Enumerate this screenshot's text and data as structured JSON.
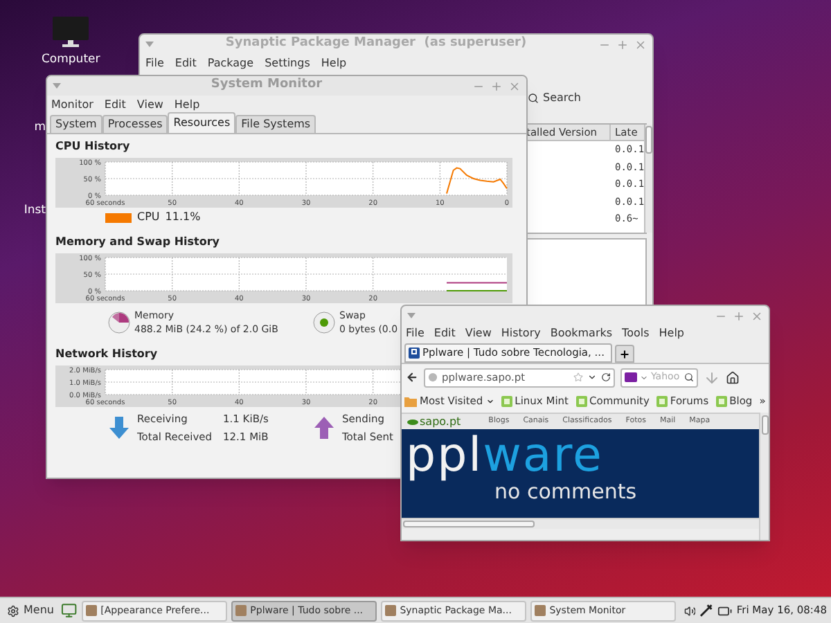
{
  "desktop": {
    "icons": [
      {
        "label": "Computer"
      }
    ],
    "partial_labels": [
      "m",
      "Inst"
    ]
  },
  "synaptic": {
    "title": "Synaptic Package Manager  (as superuser)",
    "menu": [
      "File",
      "Edit",
      "Package",
      "Settings",
      "Help"
    ],
    "toolbar": [
      "Search"
    ],
    "table": {
      "columns": [
        "talled Version",
        "Late"
      ],
      "latest_cells": [
        "0.0.1",
        "0.0.1",
        "0.0.1",
        "0.0.1",
        "0.6~"
      ]
    }
  },
  "system_monitor": {
    "title": "System Monitor",
    "menu": [
      "Monitor",
      "Edit",
      "View",
      "Help"
    ],
    "tabs": [
      {
        "label": "System",
        "selected": false
      },
      {
        "label": "Processes",
        "selected": false
      },
      {
        "label": "Resources",
        "selected": true
      },
      {
        "label": "File Systems",
        "selected": false
      }
    ],
    "cpu": {
      "heading": "CPU History",
      "chart_data": {
        "type": "line",
        "grid": true,
        "xlim": [
          60,
          0
        ],
        "ylim": [
          0,
          100
        ],
        "xticks": [
          {
            "value": 60,
            "label": "60 seconds"
          },
          50,
          40,
          30,
          20,
          10,
          0
        ],
        "yticks": [
          {
            "value": 100,
            "label": "100 %"
          },
          {
            "value": 50,
            "label": "50 %"
          },
          {
            "value": 0,
            "label": "0 %"
          }
        ],
        "x": [
          9,
          8.5,
          8,
          7.5,
          7,
          6,
          5,
          4,
          3,
          2,
          1,
          0.5,
          0
        ],
        "series": [
          {
            "name": "CPU",
            "color": "#f57900",
            "values": [
              5,
              40,
              75,
              82,
              80,
              60,
              50,
              45,
              42,
              40,
              48,
              35,
              20
            ]
          }
        ]
      },
      "legend": [
        {
          "value": "11.1%"
        }
      ]
    },
    "memory": {
      "heading": "Memory and Swap History",
      "chart_data": {
        "type": "line",
        "grid": true,
        "xlim": [
          60,
          0
        ],
        "ylim": [
          0,
          100
        ],
        "xticks": [
          {
            "value": 60,
            "label": "60 seconds"
          },
          50,
          40,
          30,
          20
        ],
        "yticks": [
          {
            "value": 100,
            "label": "100 %"
          },
          {
            "value": 50,
            "label": "50 %"
          },
          {
            "value": 0,
            "label": "0 %"
          }
        ],
        "x": [
          9,
          0
        ],
        "series": [
          {
            "name": "Memory",
            "color": "#ad3b7f",
            "values": [
              24,
              24
            ]
          },
          {
            "name": "Swap",
            "color": "#4e9a06",
            "values": [
              0,
              0
            ]
          }
        ]
      },
      "items": [
        {
          "kind": "pie",
          "detail": "488.2 MiB (24.2 %) of 2.0 GiB"
        },
        {
          "kind": "dot",
          "detail": "0 bytes (0.0"
        }
      ]
    },
    "network": {
      "heading": "Network History",
      "chart_data": {
        "type": "line",
        "grid": true,
        "xlim": [
          60,
          0
        ],
        "ylim": [
          0,
          2
        ],
        "xticks": [
          {
            "value": 60,
            "label": "60 seconds"
          },
          50,
          40,
          30,
          20
        ],
        "yticks": [
          {
            "value": 2,
            "label": "2.0 MiB/s"
          },
          {
            "value": 1,
            "label": "1.0 MiB/s"
          },
          {
            "value": 0,
            "label": "0.0 MiB/s"
          }
        ]
      },
      "items": [
        {
          "kind": "down",
          "label": "Receiving",
          "value": "1.1 KiB/s",
          "total_label": "Total Received",
          "total": "12.1 MiB"
        },
        {
          "kind": "up",
          "label": "Sending",
          "total_label": "Total Sent"
        }
      ]
    }
  },
  "firefox": {
    "menu": [
      "File",
      "Edit",
      "View",
      "History",
      "Bookmarks",
      "Tools",
      "Help"
    ],
    "tabs": [
      {
        "label": "Pplware | Tudo sobre Tecnologia, ...",
        "selected": true
      }
    ],
    "url": "pplware.sapo.pt",
    "search_placeholder": "Yahoo",
    "bookmarks": [
      {
        "kind": "menu",
        "label": "Most Visited"
      },
      {
        "kind": "link",
        "label": "Linux Mint"
      },
      {
        "kind": "link",
        "label": "Community"
      },
      {
        "kind": "link",
        "label": "Forums"
      },
      {
        "kind": "link",
        "label": "Blog"
      }
    ],
    "bookmarks_overflow": "»",
    "page": {
      "site": "sapo.pt",
      "links": [
        "Blogs",
        "Canais",
        "Classificados",
        "Fotos",
        "Mail",
        "Mapa"
      ],
      "logo": {
        "first": "ppl",
        "second": "ware",
        "tagline": "no comments"
      }
    }
  },
  "taskbar": {
    "menu_label": "Menu",
    "tasks": [
      {
        "label": "[Appearance Prefere...",
        "selected": false
      },
      {
        "label": "Pplware | Tudo sobre ...",
        "selected": true
      },
      {
        "label": "Synaptic Package Ma...",
        "selected": false
      },
      {
        "label": "System Monitor",
        "selected": false
      }
    ],
    "clock": "Fri May 16, 08:48"
  }
}
